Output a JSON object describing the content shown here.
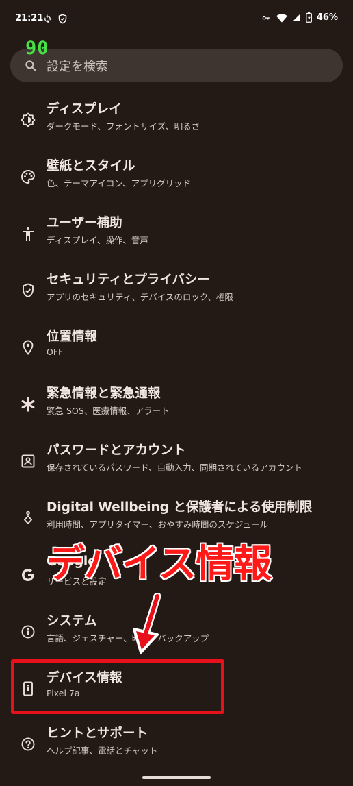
{
  "status_bar": {
    "time": "21:21",
    "battery_percent": "46%"
  },
  "fps_overlay": "90",
  "search": {
    "placeholder": "設定を検索"
  },
  "items": [
    {
      "id": "display",
      "icon": "brightness-icon",
      "title": "ディスプレイ",
      "subtitle": "ダークモード、フォントサイズ、明るさ"
    },
    {
      "id": "wallpaper",
      "icon": "palette-icon",
      "title": "壁紙とスタイル",
      "subtitle": "色、テーマアイコン、アプリグリッド"
    },
    {
      "id": "accessibility",
      "icon": "accessibility-icon",
      "title": "ユーザー補助",
      "subtitle": "ディスプレイ、操作、音声"
    },
    {
      "id": "security",
      "icon": "shield-check-icon",
      "title": "セキュリティとプライバシー",
      "subtitle": "アプリのセキュリティ、デバイスのロック、権限"
    },
    {
      "id": "location",
      "icon": "location-pin-icon",
      "title": "位置情報",
      "subtitle": "OFF"
    },
    {
      "id": "emergency",
      "icon": "asterisk-icon",
      "title": "緊急情報と緊急通報",
      "subtitle": "緊急 SOS、医療情報、アラート"
    },
    {
      "id": "passwords",
      "icon": "account-box-icon",
      "title": "パスワードとアカウント",
      "subtitle": "保存されているパスワード、自動入力、同期されているアカウント"
    },
    {
      "id": "wellbeing",
      "icon": "wellbeing-icon",
      "title": "Digital Wellbeing と保護者による使用制限",
      "subtitle": "利用時間、アプリタイマー、おやすみ時間のスケジュール"
    },
    {
      "id": "google",
      "icon": "google-g-icon",
      "title": "Google",
      "subtitle": "サービスと設定"
    },
    {
      "id": "system",
      "icon": "info-icon",
      "title": "システム",
      "subtitle": "言語、ジェスチャー、時刻、バックアップ"
    },
    {
      "id": "about",
      "icon": "phone-info-icon",
      "title": "デバイス情報",
      "subtitle": "Pixel 7a"
    },
    {
      "id": "help",
      "icon": "help-circle-icon",
      "title": "ヒントとサポート",
      "subtitle": "ヘルプ記事、電話とチャット"
    }
  ],
  "annotation": {
    "label": "デバイス情報",
    "color": "#ff1a1a"
  },
  "colors": {
    "background": "#231a16",
    "search_bg": "#3e3430",
    "highlight": "#e8101a"
  }
}
